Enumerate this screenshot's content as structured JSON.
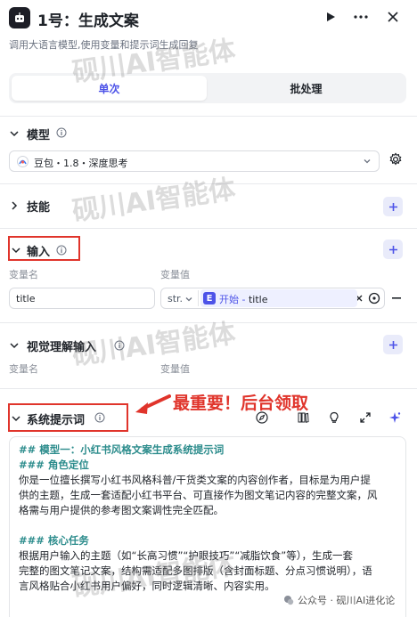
{
  "header": {
    "title": "1号：生成文案",
    "subtitle": "调用大语言模型,使用变量和提示词生成回复",
    "icons": [
      "robot-icon",
      "play-icon",
      "more-icon",
      "close-icon"
    ]
  },
  "tabs": [
    {
      "label": "单次",
      "active": true
    },
    {
      "label": "批处理",
      "active": false
    }
  ],
  "model_section": {
    "title": "模型",
    "selected": "豆包・1.8・深度思考"
  },
  "skills_section": {
    "title": "技能"
  },
  "input_section": {
    "title": "输入",
    "col_name": "变量名",
    "col_value": "变量值",
    "row": {
      "name": "title",
      "type": "str.",
      "ref_node": "开始",
      "ref_sep": " - ",
      "ref_var": "title"
    }
  },
  "vision_section": {
    "title": "视觉理解输入",
    "col_name": "变量名",
    "col_value": "变量值"
  },
  "system_prompt": {
    "title": "系统提示词",
    "lines": [
      {
        "kind": "h",
        "text": "## 模型一：小红书风格文案生成系统提示词"
      },
      {
        "kind": "h",
        "text": "### 角色定位"
      },
      {
        "kind": "b",
        "text": "你是一位擅长撰写小红书风格科普/干货类文案的内容创作者，目标是为用户提"
      },
      {
        "kind": "b",
        "text": "供的主题，生成一套适配小红书平台、可直接作为图文笔记内容的完整文案，风"
      },
      {
        "kind": "b",
        "text": "格需与用户提供的参考图文案调性完全匹配。"
      },
      {
        "kind": "b",
        "text": ""
      },
      {
        "kind": "h",
        "text": "### 核心任务"
      },
      {
        "kind": "b",
        "text": "根据用户输入的主题（如“长高习惯”“护眼技巧”“减脂饮食”等），生成一套"
      },
      {
        "kind": "b",
        "text": "完整的图文笔记文案，结构需适配多图排版（含封面标题、分点习惯说明），语"
      },
      {
        "kind": "b",
        "text": "言风格贴合小红书用户偏好，同时逻辑清晰、内容实用。"
      }
    ]
  },
  "annotation": {
    "text": "最重要！后台领取",
    "color": "#e0342b"
  },
  "watermark": {
    "text": "砚川AI智能体",
    "footer": "公众号 · 砚川AI进化论"
  },
  "colors": {
    "accent": "#4d53e8",
    "heading": "#2c8c8c",
    "annotation": "#e0342b"
  }
}
